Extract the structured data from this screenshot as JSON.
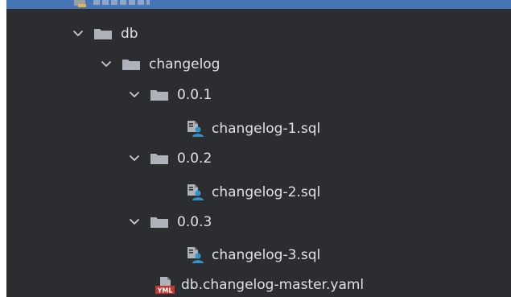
{
  "tree": {
    "db": {
      "label": "db",
      "icon": "folder-icon",
      "expanded": true
    },
    "changelog": {
      "label": "changelog",
      "icon": "folder-icon",
      "expanded": true
    },
    "v001": {
      "label": "0.0.1",
      "icon": "folder-icon",
      "expanded": true
    },
    "file1": {
      "label": "changelog-1.sql",
      "icon": "sql-file-icon"
    },
    "v002": {
      "label": "0.0.2",
      "icon": "folder-icon",
      "expanded": true
    },
    "file2": {
      "label": "changelog-2.sql",
      "icon": "sql-file-icon"
    },
    "v003": {
      "label": "0.0.3",
      "icon": "folder-icon",
      "expanded": true
    },
    "file3": {
      "label": "changelog-3.sql",
      "icon": "sql-file-icon"
    },
    "master": {
      "label": "db.changelog-master.yaml",
      "icon": "yaml-file-icon",
      "badge": "YML"
    }
  },
  "colors": {
    "panel_bg": "#2b2d30",
    "selection_strip": "#4675b8",
    "text": "#dfe1e5",
    "folder": "#aeb3bb",
    "chevron": "#c9ccd1",
    "sql_user": "#3592c4",
    "yaml_badge": "#c7372f"
  }
}
